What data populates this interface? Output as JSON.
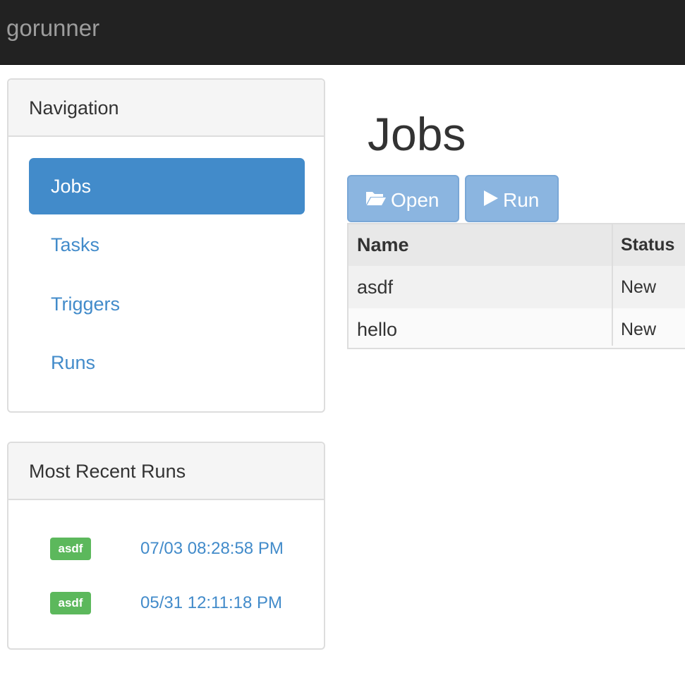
{
  "app": {
    "brand": "gorunner"
  },
  "navigation": {
    "heading": "Navigation",
    "items": [
      {
        "label": "Jobs",
        "active": true
      },
      {
        "label": "Tasks",
        "active": false
      },
      {
        "label": "Triggers",
        "active": false
      },
      {
        "label": "Runs",
        "active": false
      }
    ]
  },
  "recent_runs": {
    "heading": "Most Recent Runs",
    "runs": [
      {
        "job": "asdf",
        "time": "07/03 08:28:58 PM"
      },
      {
        "job": "asdf",
        "time": "05/31 12:11:18 PM"
      }
    ]
  },
  "main": {
    "title": "Jobs",
    "toolbar": {
      "open_label": "Open",
      "open_icon": "folder-open-icon",
      "run_label": "Run",
      "run_icon": "play-icon"
    },
    "table": {
      "headers": [
        "Name",
        "Status"
      ],
      "rows": [
        [
          "asdf",
          "New"
        ],
        [
          "hello",
          "New"
        ]
      ]
    }
  },
  "colors": {
    "navbar": "#222222",
    "accent": "#428bca",
    "success": "#5cb85c"
  }
}
